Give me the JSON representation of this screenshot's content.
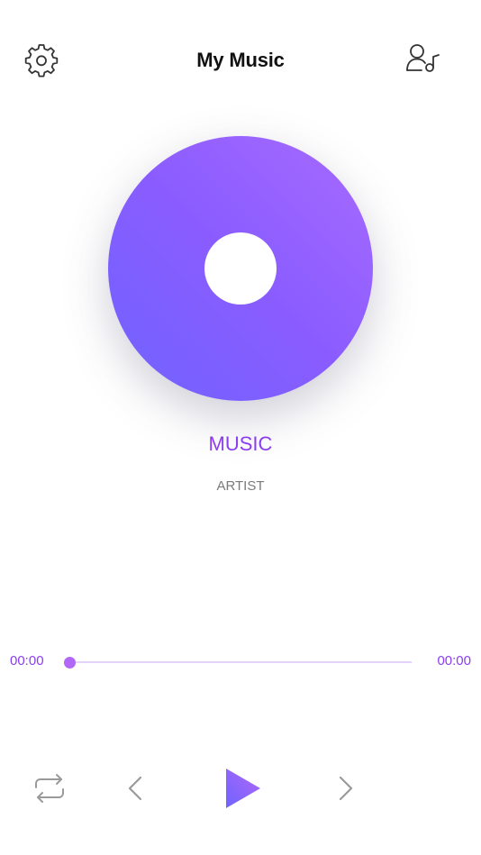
{
  "header": {
    "title": "My Music",
    "settings_icon": "gear-icon",
    "profile_icon": "user-music-icon"
  },
  "artwork": {
    "icon": "vinyl-disc-icon",
    "gradient_start": "#6f63ff",
    "gradient_end": "#a86bff"
  },
  "track": {
    "title": "MUSIC",
    "artist": "ARTIST"
  },
  "progress": {
    "current_time": "00:00",
    "total_time": "00:00",
    "fraction": 0.0
  },
  "controls": {
    "repeat_icon": "repeat-icon",
    "prev_icon": "chevron-left-icon",
    "play_icon": "play-icon",
    "next_icon": "chevron-right-icon"
  },
  "colors": {
    "accent": "#8a3ef0",
    "track_bg": "#e4d3ff",
    "text_secondary": "#7a7a7a",
    "icon_gray": "#9a9a9a"
  }
}
